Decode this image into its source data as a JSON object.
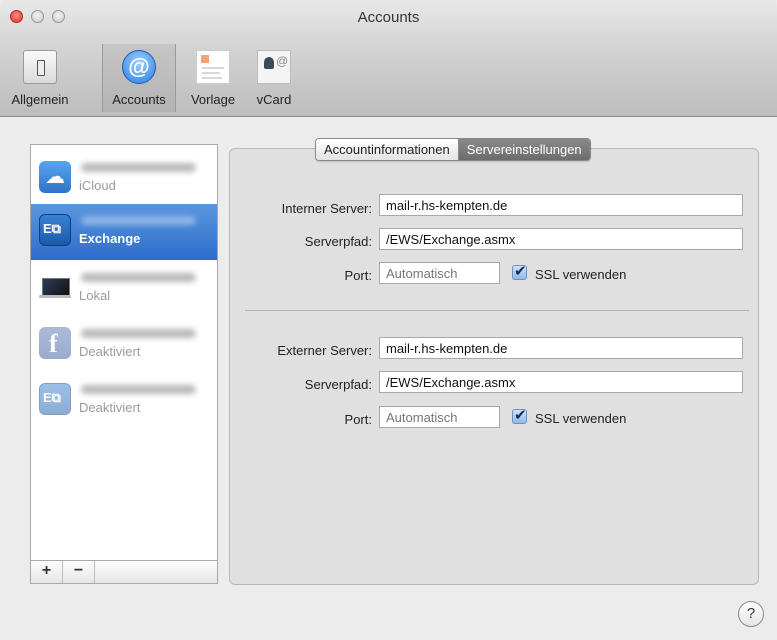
{
  "window": {
    "title": "Accounts"
  },
  "toolbar": {
    "items": [
      {
        "label": "Allgemein",
        "icon": "general-icon"
      },
      {
        "label": "Accounts",
        "icon": "at-sign-icon",
        "selected": true
      },
      {
        "label": "Vorlage",
        "icon": "template-icon"
      },
      {
        "label": "vCard",
        "icon": "vcard-icon"
      }
    ]
  },
  "sidebar": {
    "accounts": [
      {
        "subtitle": "iCloud",
        "icon": "icloud-icon",
        "name_blurred": true
      },
      {
        "subtitle": "Exchange",
        "icon": "exchange-icon",
        "name_blurred": true,
        "selected": true
      },
      {
        "subtitle": "Lokal",
        "icon": "laptop-icon",
        "name_blurred": true
      },
      {
        "subtitle": "Deaktiviert",
        "icon": "facebook-icon",
        "name_blurred": true
      },
      {
        "subtitle": "Deaktiviert",
        "icon": "exchange-icon",
        "name_blurred": true
      }
    ],
    "add_label": "+",
    "remove_label": "−"
  },
  "tabs": [
    {
      "label": "Accountinformationen",
      "active": false
    },
    {
      "label": "Servereinstellungen",
      "active": true
    }
  ],
  "internal": {
    "server_label": "Interner Server:",
    "server_value": "mail-r.hs-kempten.de",
    "path_label": "Serverpfad:",
    "path_value": "/EWS/Exchange.asmx",
    "port_label": "Port:",
    "port_placeholder": "Automatisch",
    "ssl_label": "SSL verwenden",
    "ssl_checked": true
  },
  "external": {
    "server_label": "Externer Server:",
    "server_value": "mail-r.hs-kempten.de",
    "path_label": "Serverpfad:",
    "path_value": "/EWS/Exchange.asmx",
    "port_label": "Port:",
    "port_placeholder": "Automatisch",
    "ssl_label": "SSL verwenden",
    "ssl_checked": true
  },
  "help": {
    "label": "?"
  }
}
